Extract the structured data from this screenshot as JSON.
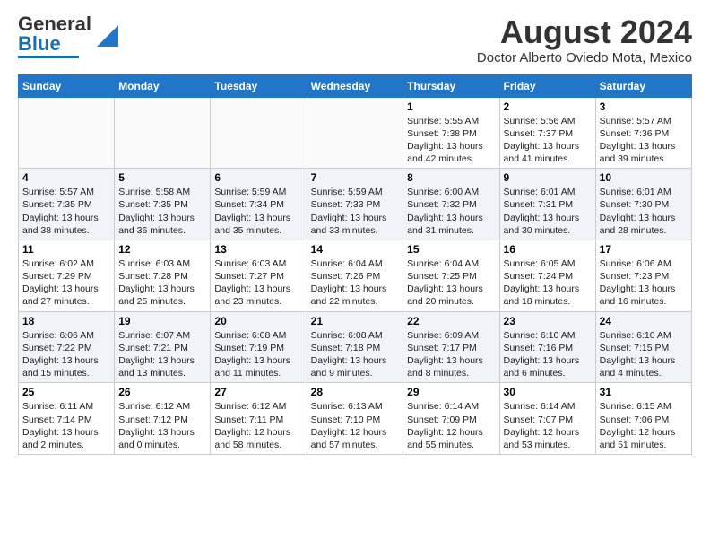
{
  "header": {
    "logo_line1": "General",
    "logo_line2": "Blue",
    "month_year": "August 2024",
    "location": "Doctor Alberto Oviedo Mota, Mexico"
  },
  "days_of_week": [
    "Sunday",
    "Monday",
    "Tuesday",
    "Wednesday",
    "Thursday",
    "Friday",
    "Saturday"
  ],
  "weeks": [
    [
      {
        "day": "",
        "info": ""
      },
      {
        "day": "",
        "info": ""
      },
      {
        "day": "",
        "info": ""
      },
      {
        "day": "",
        "info": ""
      },
      {
        "day": "1",
        "info": "Sunrise: 5:55 AM\nSunset: 7:38 PM\nDaylight: 13 hours\nand 42 minutes."
      },
      {
        "day": "2",
        "info": "Sunrise: 5:56 AM\nSunset: 7:37 PM\nDaylight: 13 hours\nand 41 minutes."
      },
      {
        "day": "3",
        "info": "Sunrise: 5:57 AM\nSunset: 7:36 PM\nDaylight: 13 hours\nand 39 minutes."
      }
    ],
    [
      {
        "day": "4",
        "info": "Sunrise: 5:57 AM\nSunset: 7:35 PM\nDaylight: 13 hours\nand 38 minutes."
      },
      {
        "day": "5",
        "info": "Sunrise: 5:58 AM\nSunset: 7:35 PM\nDaylight: 13 hours\nand 36 minutes."
      },
      {
        "day": "6",
        "info": "Sunrise: 5:59 AM\nSunset: 7:34 PM\nDaylight: 13 hours\nand 35 minutes."
      },
      {
        "day": "7",
        "info": "Sunrise: 5:59 AM\nSunset: 7:33 PM\nDaylight: 13 hours\nand 33 minutes."
      },
      {
        "day": "8",
        "info": "Sunrise: 6:00 AM\nSunset: 7:32 PM\nDaylight: 13 hours\nand 31 minutes."
      },
      {
        "day": "9",
        "info": "Sunrise: 6:01 AM\nSunset: 7:31 PM\nDaylight: 13 hours\nand 30 minutes."
      },
      {
        "day": "10",
        "info": "Sunrise: 6:01 AM\nSunset: 7:30 PM\nDaylight: 13 hours\nand 28 minutes."
      }
    ],
    [
      {
        "day": "11",
        "info": "Sunrise: 6:02 AM\nSunset: 7:29 PM\nDaylight: 13 hours\nand 27 minutes."
      },
      {
        "day": "12",
        "info": "Sunrise: 6:03 AM\nSunset: 7:28 PM\nDaylight: 13 hours\nand 25 minutes."
      },
      {
        "day": "13",
        "info": "Sunrise: 6:03 AM\nSunset: 7:27 PM\nDaylight: 13 hours\nand 23 minutes."
      },
      {
        "day": "14",
        "info": "Sunrise: 6:04 AM\nSunset: 7:26 PM\nDaylight: 13 hours\nand 22 minutes."
      },
      {
        "day": "15",
        "info": "Sunrise: 6:04 AM\nSunset: 7:25 PM\nDaylight: 13 hours\nand 20 minutes."
      },
      {
        "day": "16",
        "info": "Sunrise: 6:05 AM\nSunset: 7:24 PM\nDaylight: 13 hours\nand 18 minutes."
      },
      {
        "day": "17",
        "info": "Sunrise: 6:06 AM\nSunset: 7:23 PM\nDaylight: 13 hours\nand 16 minutes."
      }
    ],
    [
      {
        "day": "18",
        "info": "Sunrise: 6:06 AM\nSunset: 7:22 PM\nDaylight: 13 hours\nand 15 minutes."
      },
      {
        "day": "19",
        "info": "Sunrise: 6:07 AM\nSunset: 7:21 PM\nDaylight: 13 hours\nand 13 minutes."
      },
      {
        "day": "20",
        "info": "Sunrise: 6:08 AM\nSunset: 7:19 PM\nDaylight: 13 hours\nand 11 minutes."
      },
      {
        "day": "21",
        "info": "Sunrise: 6:08 AM\nSunset: 7:18 PM\nDaylight: 13 hours\nand 9 minutes."
      },
      {
        "day": "22",
        "info": "Sunrise: 6:09 AM\nSunset: 7:17 PM\nDaylight: 13 hours\nand 8 minutes."
      },
      {
        "day": "23",
        "info": "Sunrise: 6:10 AM\nSunset: 7:16 PM\nDaylight: 13 hours\nand 6 minutes."
      },
      {
        "day": "24",
        "info": "Sunrise: 6:10 AM\nSunset: 7:15 PM\nDaylight: 13 hours\nand 4 minutes."
      }
    ],
    [
      {
        "day": "25",
        "info": "Sunrise: 6:11 AM\nSunset: 7:14 PM\nDaylight: 13 hours\nand 2 minutes."
      },
      {
        "day": "26",
        "info": "Sunrise: 6:12 AM\nSunset: 7:12 PM\nDaylight: 13 hours\nand 0 minutes."
      },
      {
        "day": "27",
        "info": "Sunrise: 6:12 AM\nSunset: 7:11 PM\nDaylight: 12 hours\nand 58 minutes."
      },
      {
        "day": "28",
        "info": "Sunrise: 6:13 AM\nSunset: 7:10 PM\nDaylight: 12 hours\nand 57 minutes."
      },
      {
        "day": "29",
        "info": "Sunrise: 6:14 AM\nSunset: 7:09 PM\nDaylight: 12 hours\nand 55 minutes."
      },
      {
        "day": "30",
        "info": "Sunrise: 6:14 AM\nSunset: 7:07 PM\nDaylight: 12 hours\nand 53 minutes."
      },
      {
        "day": "31",
        "info": "Sunrise: 6:15 AM\nSunset: 7:06 PM\nDaylight: 12 hours\nand 51 minutes."
      }
    ]
  ]
}
